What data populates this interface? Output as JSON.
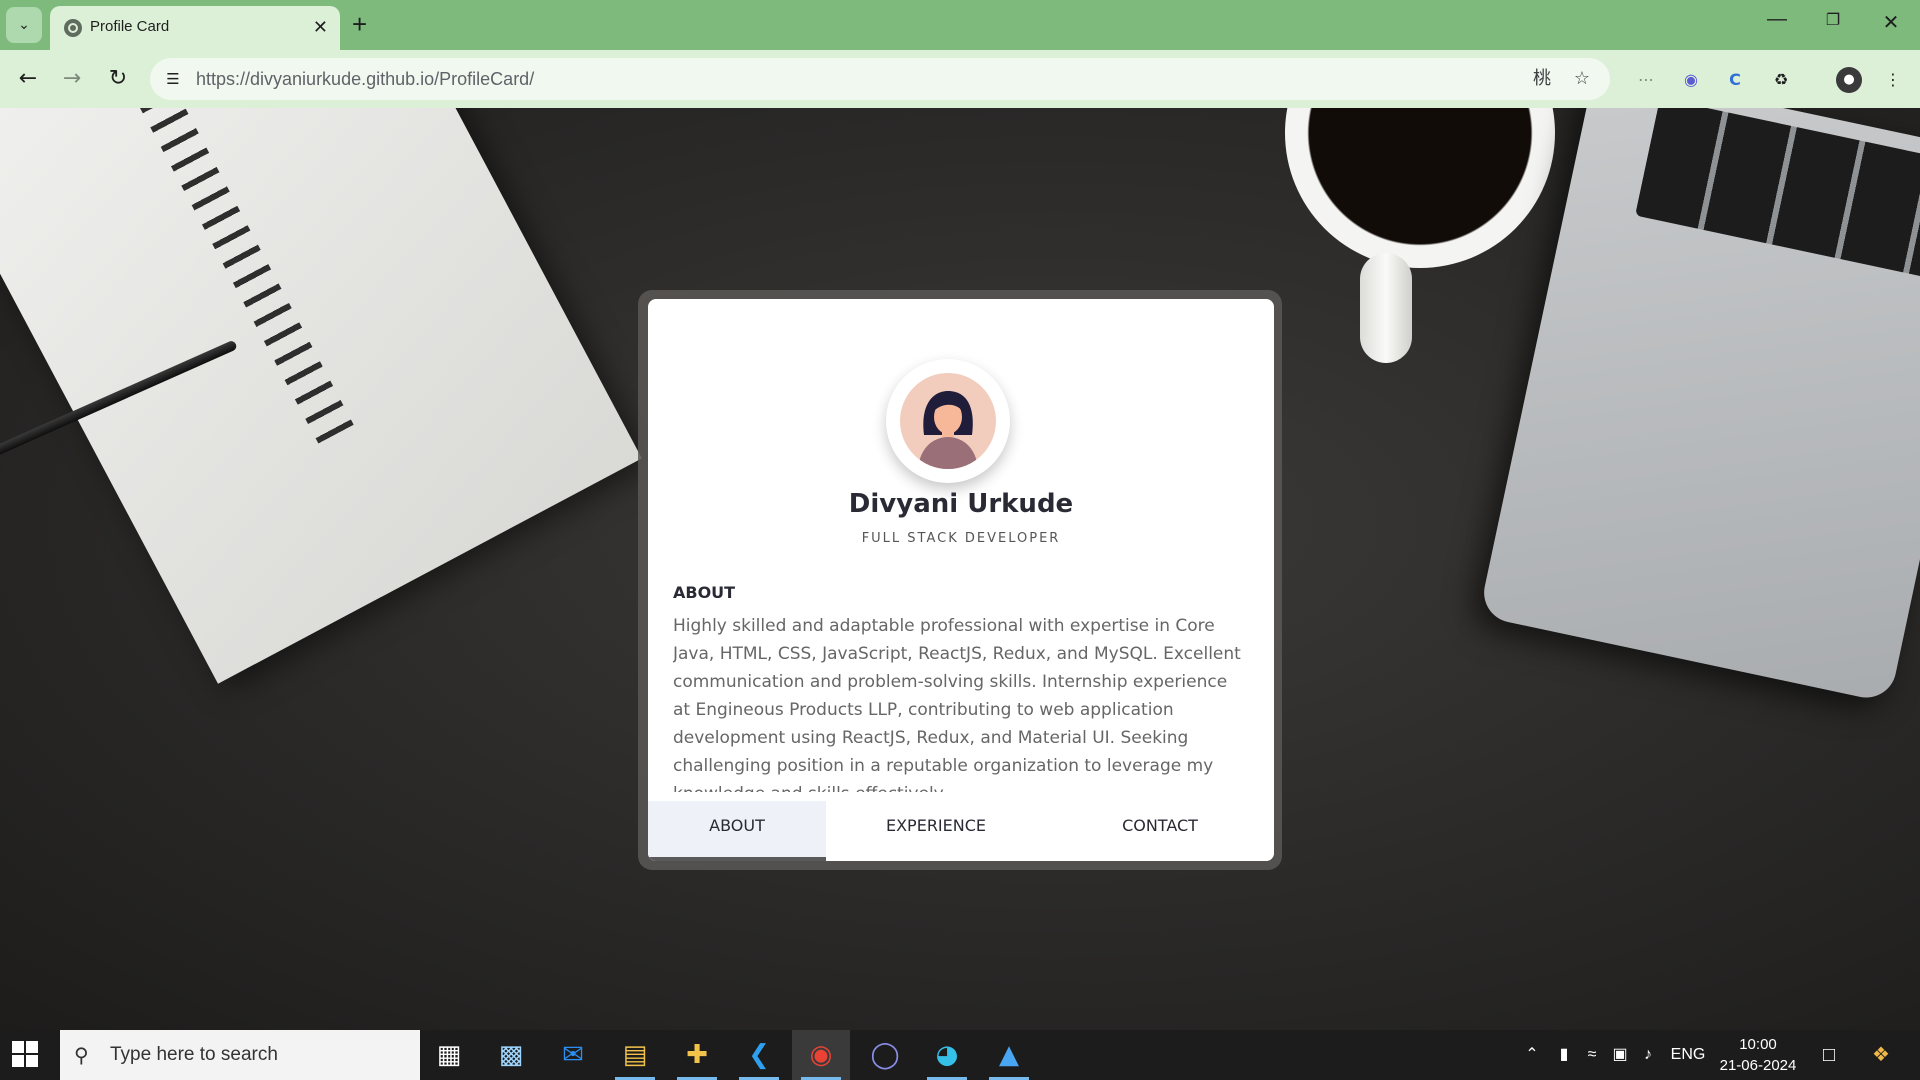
{
  "browser": {
    "tab_title": "Profile Card",
    "url_host": "https://divyaniurkude.github.io",
    "url_path": "/ProfileCard/",
    "icons": [
      "tab-search-icon",
      "globe-icon",
      "close-icon",
      "plus-icon",
      "minimize-icon",
      "restore-icon",
      "window-close-icon",
      "back-icon",
      "forward-icon",
      "reload-icon",
      "site-info-icon",
      "translate-icon",
      "star-icon",
      "extensions-icon",
      "profile-avatar-icon",
      "menu-icon"
    ]
  },
  "profile": {
    "name": "Divyani Urkude",
    "role": "FULL STACK DEVELOPER",
    "about_heading": "ABOUT",
    "about_text": "Highly skilled and adaptable professional with expertise in Core Java, HTML, CSS, JavaScript, ReactJS, Redux, and MySQL. Excellent communication and problem-solving skills. Internship experience at Engineous Products LLP, contributing to web application development using ReactJS, Redux, and Material UI. Seeking challenging position in a reputable organization to leverage my knowledge and skills effectively.",
    "tabs": [
      {
        "label": "ABOUT",
        "active": true
      },
      {
        "label": "EXPERIENCE",
        "active": false
      },
      {
        "label": "CONTACT",
        "active": false
      }
    ]
  },
  "taskbar": {
    "search_placeholder": "Type here to search",
    "language": "ENG",
    "time": "10:00",
    "date": "21-06-2024"
  },
  "colors": {
    "tabbar": "#7dba7c",
    "toolbar": "#dcf0d8",
    "active_card_tab": "#eef2f8"
  }
}
